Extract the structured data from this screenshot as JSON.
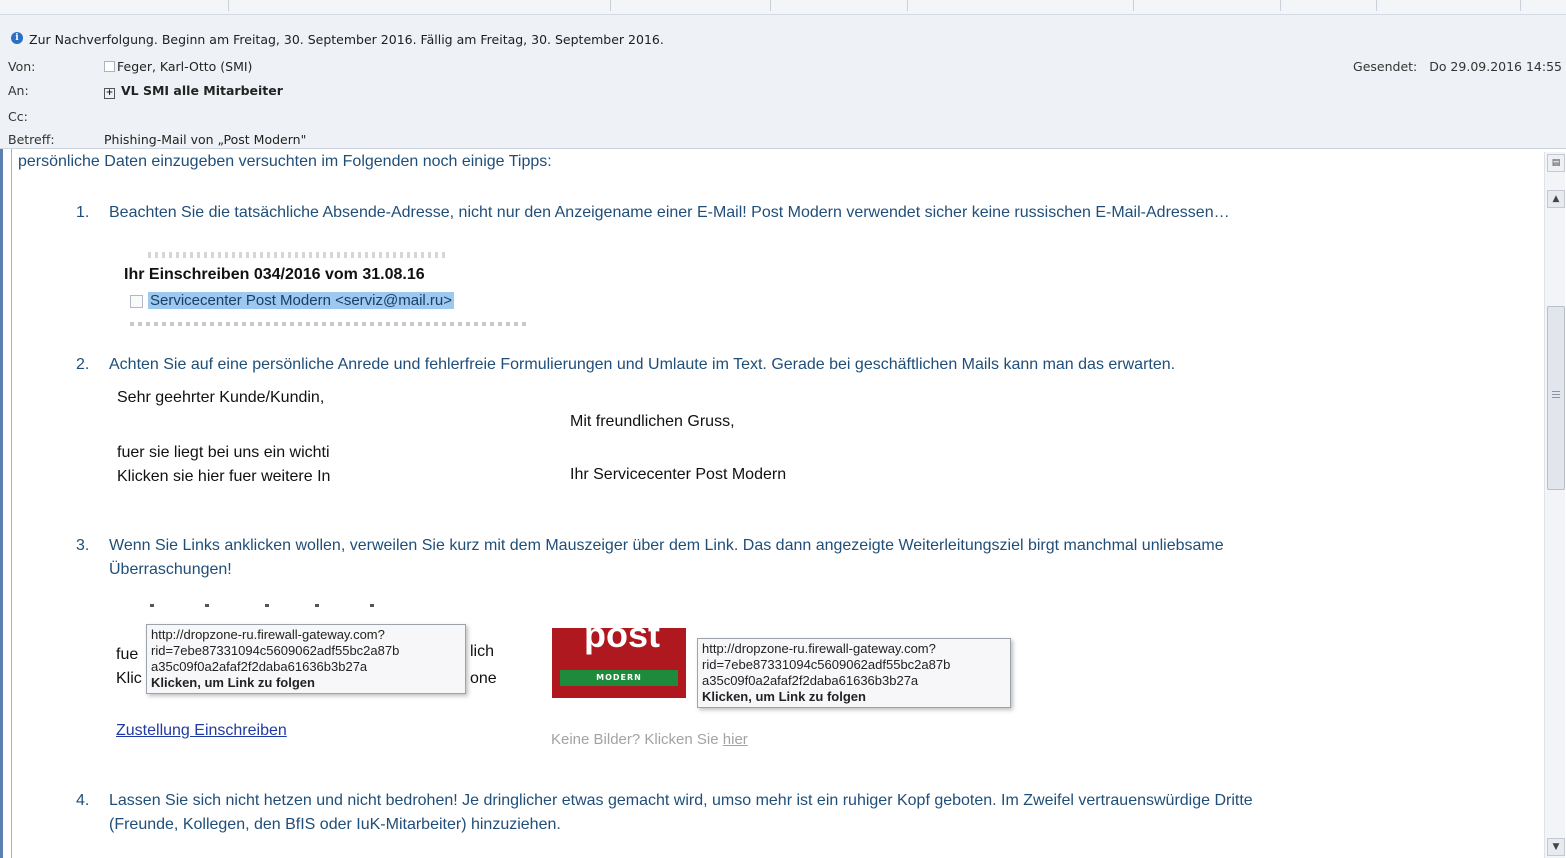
{
  "header": {
    "followup": "Zur Nachverfolgung.  Beginn am Freitag, 30. September 2016.  Fällig am Freitag, 30. September 2016.",
    "from_label": "Von:",
    "from_value": "Feger, Karl-Otto (SMI)",
    "to_label": "An:",
    "to_value": "VL SMI alle Mitarbeiter",
    "cc_label": "Cc:",
    "subject_label": "Betreff:",
    "subject_value": "Phishing-Mail von „Post Modern\"",
    "sent_label": "Gesendet:",
    "sent_value": "Do 29.09.2016 14:55"
  },
  "body": {
    "intro": "persönliche Daten einzugeben versuchten im Folgenden noch einige Tipps:",
    "tip1_num": "1.",
    "tip1": "Beachten Sie die tatsächliche Absende-Adresse, nicht nur den Anzeigename einer E-Mail! Post Modern verwendet sicher keine russischen E-Mail-Adressen…",
    "img1_subject": "Ihr Einschreiben 034/2016 vom 31.08.16",
    "img1_sender": "Servicecenter Post Modern <serviz@mail.ru>",
    "tip2_num": "2.",
    "tip2": "Achten Sie auf eine persönliche Anrede und fehlerfreie Formulierungen und Umlaute im Text. Gerade bei geschäftlichen Mails kann man das erwarten.",
    "greet1": "Sehr geehrter Kunde/Kundin,",
    "greet2": "fuer sie liegt bei uns ein wichti",
    "greet3": "Klicken sie hier fuer weitere In",
    "closing1": "Mit freundlichen Gruss,",
    "closing2": "Ihr Servicecenter Post Modern",
    "tip3_num": "3.",
    "tip3a": "Wenn Sie Links anklicken wollen, verweilen Sie kurz mit dem Mauszeiger über dem Link. Das dann angezeigte Weiterleitungsziel birgt manchmal unliebsame",
    "tip3b": "Überraschungen!",
    "tooltip_line1": "http://dropzone-ru.firewall-gateway.com?",
    "tooltip_line2": "rid=7ebe87331094c5609062adf55bc2a87b",
    "tooltip_line3": "a35c09f0a2afaf2f2daba61636b3b27a",
    "tooltip_action": "Klicken, um Link zu folgen",
    "snip_left1": "fue",
    "snip_left2": "Klic",
    "snip_right1": "lich",
    "snip_right2": "one",
    "zustellung_link": "Zustellung Einschreiben",
    "post_logo_word": "post",
    "post_logo_sub": "MODERN",
    "noimg_text": "Keine Bilder? Klicken Sie ",
    "noimg_link": "hier",
    "tip4_num": "4.",
    "tip4a": "Lassen Sie sich nicht hetzen und nicht bedrohen! Je dringlicher etwas gemacht wird, umso mehr ist ein ruhiger Kopf geboten. Im Zweifel vertrauenswürdige Dritte",
    "tip4b": "(Freunde, Kollegen, den BfIS oder IuK-Mitarbeiter) hinzuziehen."
  },
  "colors": {
    "body_text": "#1f4e79",
    "header_bg": "#eef1f5",
    "link": "#1f3aa5",
    "selection": "#9dc8f0",
    "logo_red": "#b01820",
    "logo_green": "#1d8a3c"
  },
  "icons": [
    "info-icon",
    "contact-checkbox-icon",
    "expand-plus-icon",
    "scroll-up-icon",
    "scroll-down-icon",
    "people-pane-icon"
  ]
}
